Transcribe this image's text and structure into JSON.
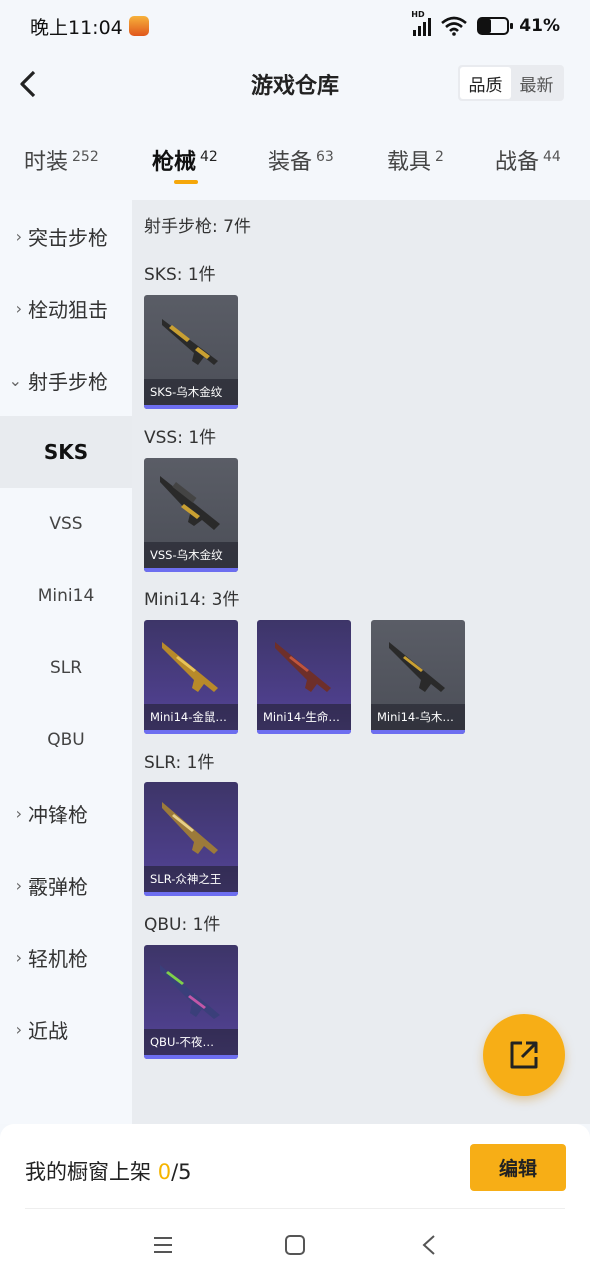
{
  "status": {
    "time": "晚上11:04",
    "network": "HD",
    "battery_text": "41%",
    "battery_level": 0.41
  },
  "header": {
    "title": "游戏仓库",
    "sort_options": [
      "品质",
      "最新"
    ],
    "sort_selected": "品质"
  },
  "tabs": [
    {
      "label": "时装",
      "count": "252",
      "active": false
    },
    {
      "label": "枪械",
      "count": "42",
      "active": true
    },
    {
      "label": "装备",
      "count": "63",
      "active": false
    },
    {
      "label": "载具",
      "count": "2",
      "active": false
    },
    {
      "label": "战备",
      "count": "44",
      "active": false
    }
  ],
  "sidebar": {
    "items": [
      {
        "label": "突击步枪",
        "chevron": "›"
      },
      {
        "label": "栓动狙击",
        "chevron": "›"
      },
      {
        "label": "射手步枪",
        "chevron": "⌄"
      },
      {
        "label": "SKS"
      },
      {
        "label": "VSS"
      },
      {
        "label": "Mini14"
      },
      {
        "label": "SLR"
      },
      {
        "label": "QBU"
      },
      {
        "label": "冲锋枪",
        "chevron": "›"
      },
      {
        "label": "霰弹枪",
        "chevron": "›"
      },
      {
        "label": "轻机枪",
        "chevron": "›"
      },
      {
        "label": "近战",
        "chevron": "›"
      }
    ],
    "active": "SKS"
  },
  "content": {
    "category_heading": "射手步枪: 7件",
    "groups": [
      {
        "heading": "SKS: 1件",
        "items": [
          {
            "name": "SKS-乌木金纹",
            "rarity": "gray"
          }
        ]
      },
      {
        "heading": "VSS: 1件",
        "items": [
          {
            "name": "VSS-乌木金纹",
            "rarity": "gray"
          }
        ]
      },
      {
        "heading": "Mini14: 3件",
        "items": [
          {
            "name": "Mini14-金鼠…",
            "rarity": "purple"
          },
          {
            "name": "Mini14-生命…",
            "rarity": "purple"
          },
          {
            "name": "Mini14-乌木…",
            "rarity": "gray"
          }
        ]
      },
      {
        "heading": "SLR: 1件",
        "items": [
          {
            "name": "SLR-众神之王",
            "rarity": "purple"
          }
        ]
      },
      {
        "heading": "QBU: 1件",
        "items": [
          {
            "name": "QBU-不夜…",
            "rarity": "purple"
          }
        ]
      }
    ]
  },
  "bottom": {
    "showcase_label": "我的橱窗上架",
    "showcase_current": "0",
    "showcase_total": "/5",
    "edit_label": "编辑"
  },
  "colors": {
    "accent": "#f7ae16",
    "rarity_bar": "#6d6ef0"
  }
}
